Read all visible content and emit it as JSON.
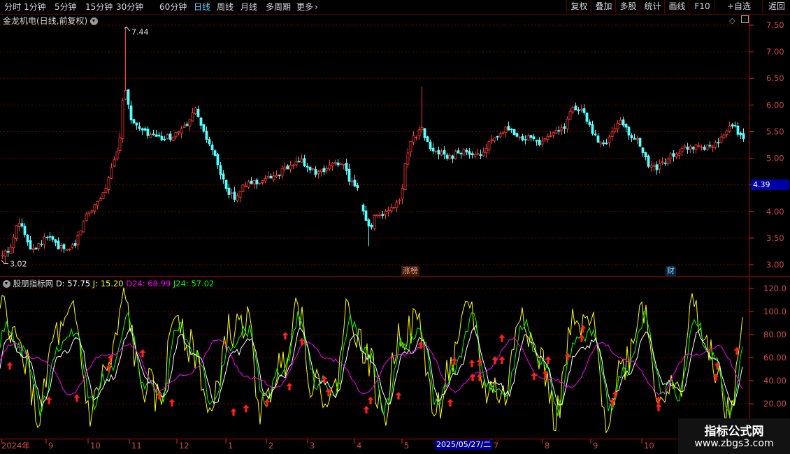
{
  "toolbar": {
    "periods": [
      "分时",
      "1分钟",
      "5分钟",
      "15分钟",
      "30分钟",
      "60分钟",
      "日线",
      "周线",
      "月线",
      "多周期",
      "更多"
    ],
    "active_period": "日线",
    "more_chevron": "›",
    "right_buttons": [
      "复权",
      "叠加",
      "多股",
      "统计",
      "画线",
      "F10",
      "+自选",
      "返回"
    ]
  },
  "main_chart": {
    "title": "金龙机电(日线,前复权)",
    "price_axis": [
      "7.50",
      "7.00",
      "6.50",
      "6.00",
      "5.50",
      "5.00",
      "4.50",
      "4.00",
      "3.50",
      "3.00"
    ],
    "high_label": "7.44",
    "low_label": "3.02",
    "current_price": "4.39",
    "tag_limit_up": "涨榜",
    "tag_finance": "财"
  },
  "indicator": {
    "name": "股朋指标网",
    "d_label": "D: 57.75",
    "j_label": "J: 15.20",
    "d24_label": "D24: 68.99",
    "j24_label": "J24: 57.02",
    "axis": [
      "120.0",
      "100.0",
      "80.00",
      "60.00",
      "40.00",
      "20.00"
    ]
  },
  "time_axis": {
    "labels": [
      "2024年",
      "9",
      "10",
      "11",
      "12",
      "1",
      "2",
      "3",
      "4",
      "5",
      "7",
      "8",
      "9",
      "10"
    ],
    "cursor_date": "2025/05/27/二"
  },
  "watermark": {
    "title": "指标公式网",
    "url": "www.zbgs3.com"
  },
  "colors": {
    "up": "#ff3c3c",
    "down": "#54ffff",
    "d_line": "#ffffff",
    "j_line": "#ffff00",
    "d24_line": "#ff00ff",
    "j24_line": "#00ff00",
    "grid": "#7a0000"
  }
}
